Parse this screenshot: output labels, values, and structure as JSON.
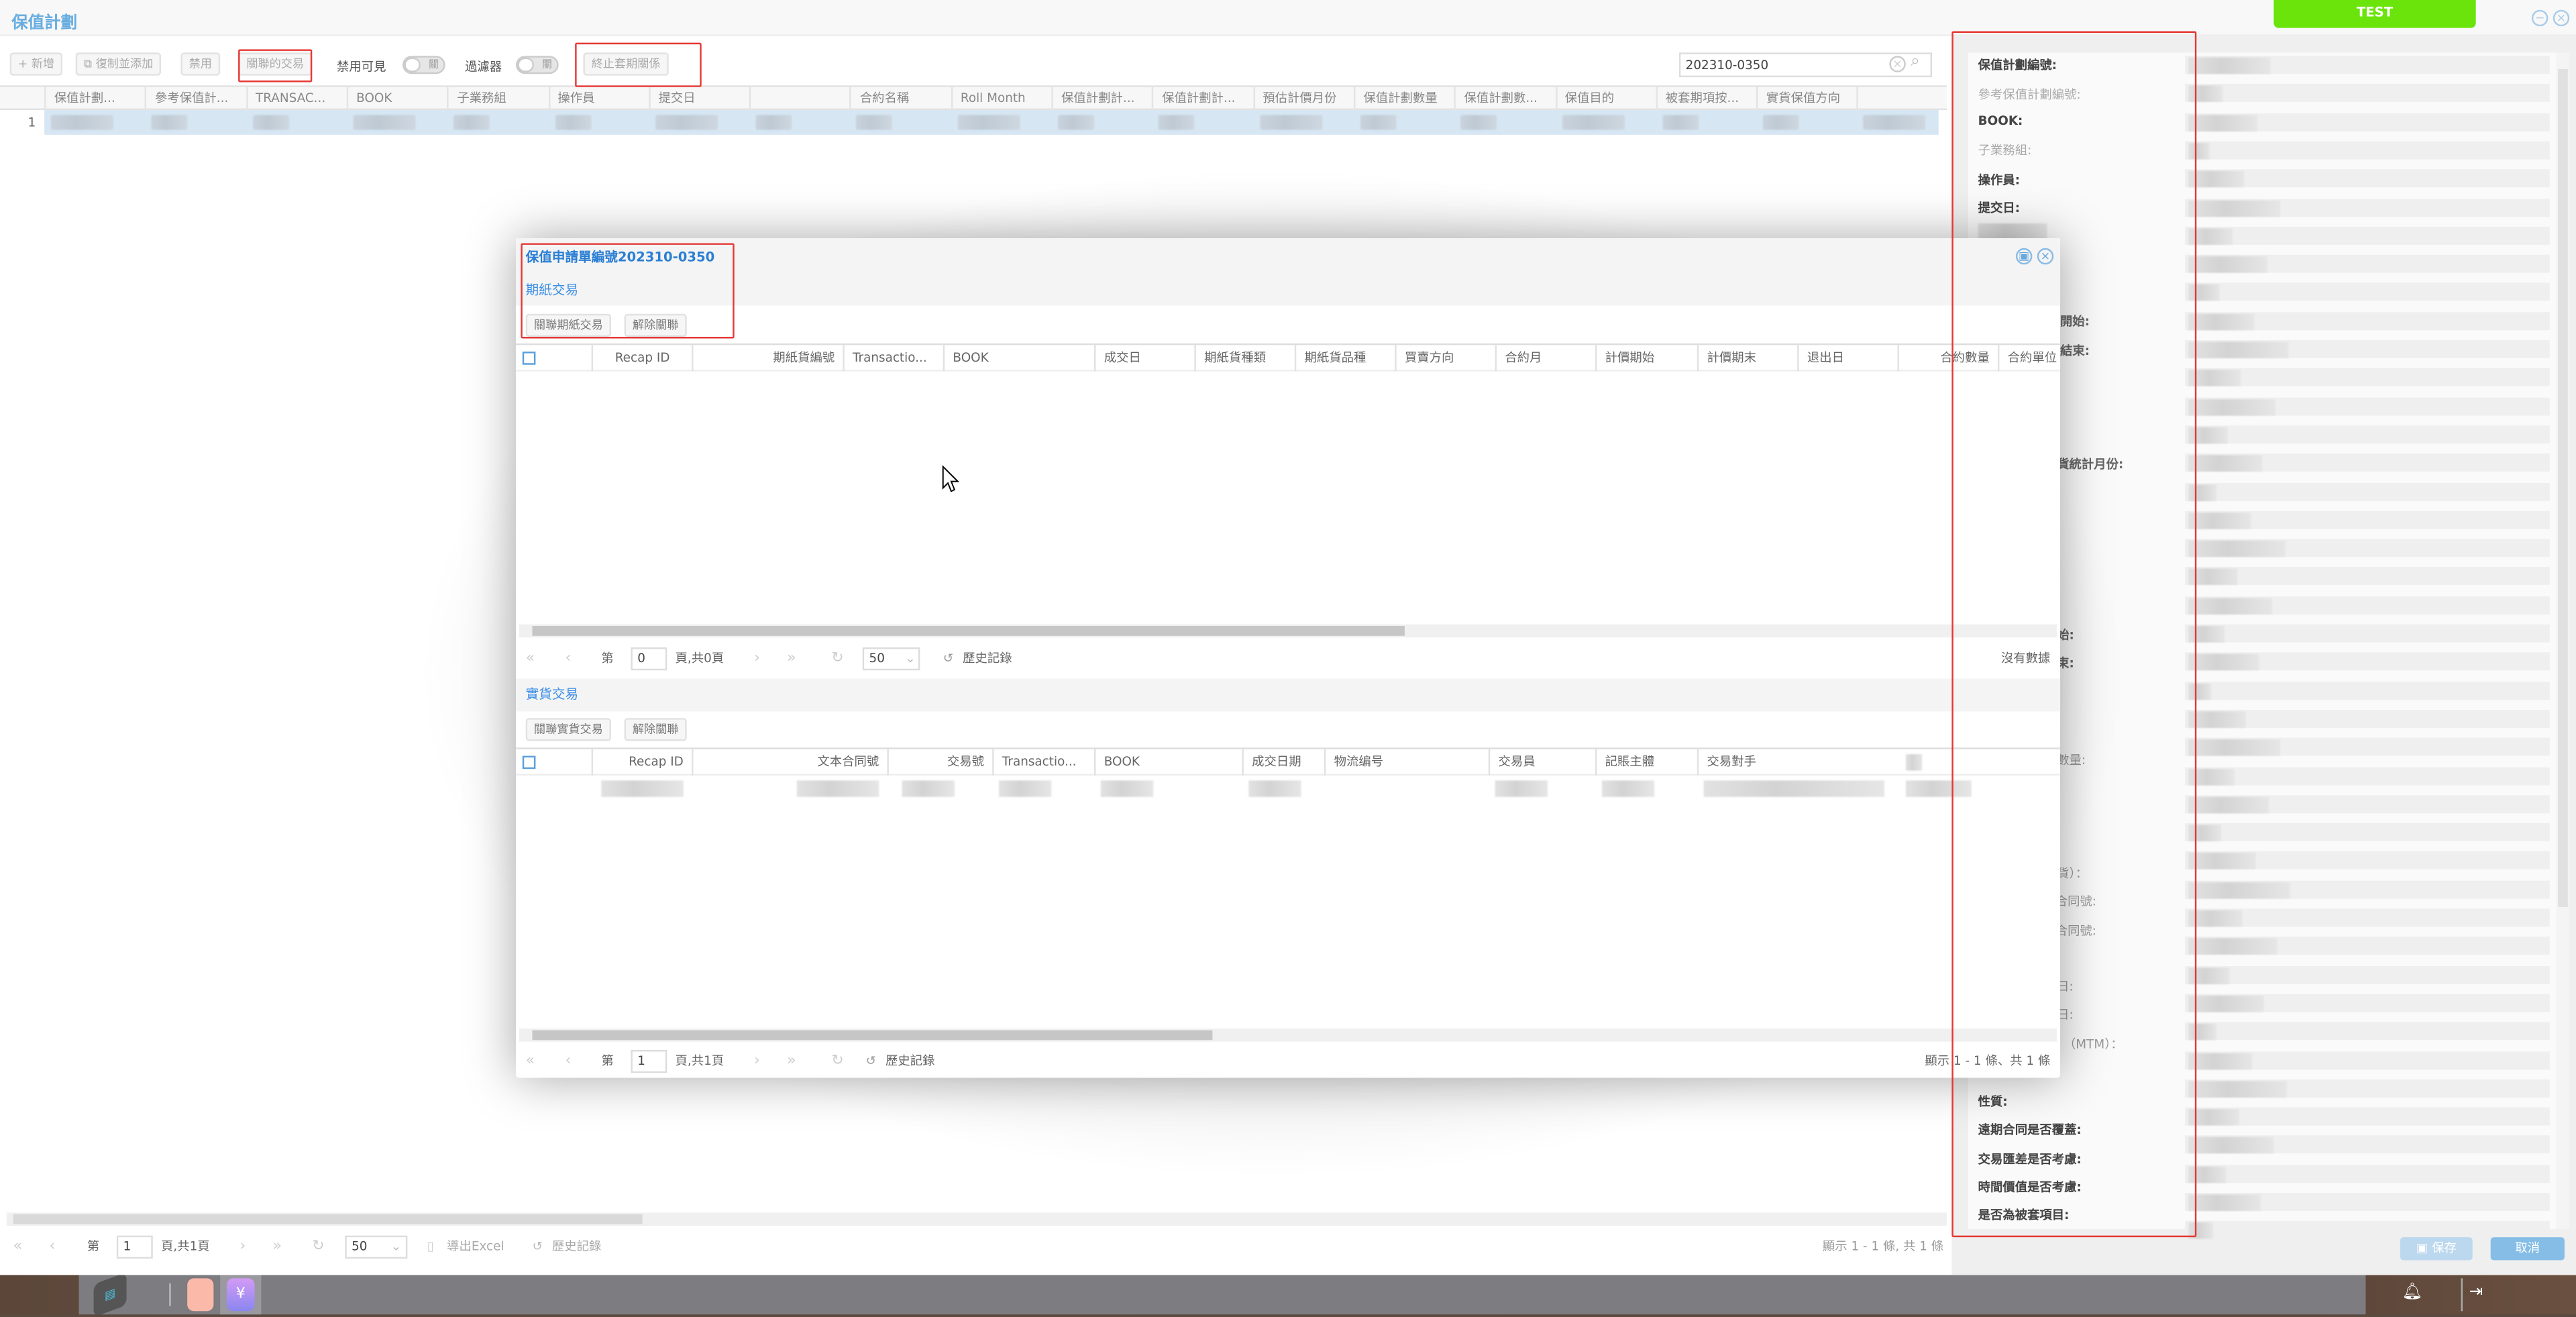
{
  "window": {
    "title": "保值計劃",
    "env_badge": "TEST",
    "accent": "#6aaee0",
    "badge_color": "#6ae40a"
  },
  "toolbar": {
    "add": "新增",
    "copy_add": "復制並添加",
    "disable": "禁用",
    "related_trades": "關聯的交易",
    "disabled_visible": "禁用可見",
    "disabled_visible_toggle": "關",
    "filter": "過濾器",
    "filter_toggle": "關",
    "terminate_hedge": "終止套期關係",
    "search_value": "202310-0350"
  },
  "grid": {
    "columns": [
      "保值計劃...",
      "參考保值計...",
      "TRANSAC...",
      "BOOK",
      "子業務組",
      "操作員",
      "提交日",
      "",
      "合約名稱",
      "Roll Month",
      "保值計劃計...",
      "保值計劃計...",
      "預估計價月份",
      "保值計劃數量",
      "保值計劃數...",
      "保值目的",
      "被套期項按...",
      "實貨保值方向",
      ""
    ],
    "rows": [
      {
        "index": "1"
      }
    ]
  },
  "pager": {
    "page_prefix": "第",
    "page": "1",
    "page_suffix": "頁,共1頁",
    "page_size": "50",
    "export": "導出Excel",
    "history": "歷史記錄",
    "summary": "顯示 1 - 1 條, 共 1 條"
  },
  "detail": {
    "labels": [
      {
        "text": "保值計劃編號:",
        "style": "b"
      },
      {
        "text": "參考保值計劃編號:",
        "style": "g"
      },
      {
        "text": "BOOK:",
        "style": "b"
      },
      {
        "text": "子業務組:",
        "style": "g"
      },
      {
        "text": "操作員:",
        "style": "b"
      },
      {
        "text": "提交日:",
        "style": "b"
      }
    ],
    "partial_labels": [
      {
        "text": "開始:",
        "style": "b"
      },
      {
        "text": "結束:",
        "style": "b"
      },
      {
        "text": "貨統計月份:",
        "style": "b"
      },
      {
        "text": "始:",
        "style": "b"
      },
      {
        "text": "束:",
        "style": "b"
      },
      {
        "text": "數量:",
        "style": "g"
      },
      {
        "text": "貨）：",
        "style": "g"
      },
      {
        "text": "合同號:",
        "style": "g"
      },
      {
        "text": "合同號:",
        "style": "g"
      },
      {
        "text": "日:",
        "style": "g"
      },
      {
        "text": "日:",
        "style": "g"
      },
      {
        "text": "（MTM）：",
        "style": "g"
      }
    ],
    "bottom_labels": [
      "性質:",
      "遠期合同是否覆蓋:",
      "交易匯差是否考慮:",
      "時間價值是否考慮:",
      "是否為被套項目:"
    ],
    "save": "保存",
    "cancel": "取消"
  },
  "modal": {
    "title": "保值申請單編號202310-0350",
    "paper": {
      "section": "期紙交易",
      "link_btn": "關聯期紙交易",
      "unlink_btn": "解除關聯",
      "columns": [
        "Recap ID",
        "期紙貨編號",
        "Transactio...",
        "BOOK",
        "成交日",
        "期紙貨種類",
        "期紙貨品種",
        "買賣方向",
        "合約月",
        "計價期始",
        "計價期末",
        "退出日",
        "合約數量",
        "合約單位"
      ],
      "pager": {
        "page_prefix": "第",
        "page": "0",
        "page_suffix": "頁,共0頁",
        "page_size": "50",
        "history": "歷史記錄",
        "summary": "沒有數據"
      }
    },
    "physical": {
      "section": "實貨交易",
      "link_btn": "關聯實貨交易",
      "unlink_btn": "解除關聯",
      "columns": [
        "Recap ID",
        "文本合同號",
        "交易號",
        "Transactio...",
        "BOOK",
        "成交日期",
        "物流编号",
        "交易員",
        "記賬主體",
        "交易對手"
      ],
      "pager": {
        "page_prefix": "第",
        "page": "1",
        "page_suffix": "頁,共1頁",
        "history": "歷史記錄",
        "summary": "顯示 1 - 1 條、共 1 條"
      }
    }
  }
}
